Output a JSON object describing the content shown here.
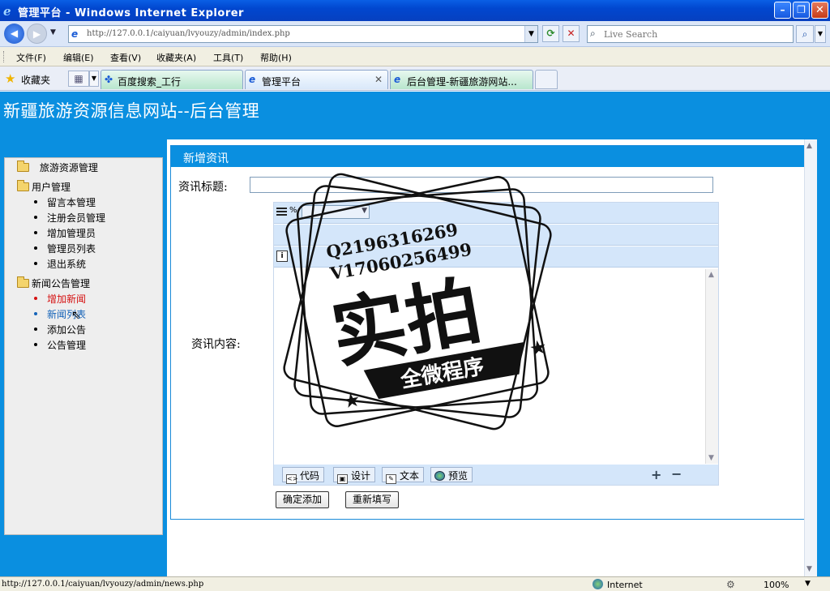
{
  "window": {
    "title": "管理平台 - Windows Internet Explorer",
    "min_glyph": "–",
    "max_glyph": "❐",
    "close_glyph": "✕"
  },
  "address_bar": {
    "url": "http://127.0.0.1/caiyuan/lvyouzy/admin/index.php",
    "search_placeholder": "Live Search"
  },
  "menu": {
    "items": [
      "文件(F)",
      "编辑(E)",
      "查看(V)",
      "收藏夹(A)",
      "工具(T)",
      "帮助(H)"
    ]
  },
  "favorites_bar": {
    "favorites_label": "收藏夹",
    "tabs": [
      {
        "label": "百度搜索_工行",
        "active": false
      },
      {
        "label": "管理平台",
        "active": true
      },
      {
        "label": "后台管理-新疆旅游网站...",
        "active": false
      }
    ]
  },
  "site": {
    "title": "新疆旅游资源信息网站--后台管理"
  },
  "sidebar": {
    "root": "旅游资源管理",
    "groups": [
      {
        "label": "用户管理",
        "items": [
          "留言本管理",
          "注册会员管理",
          "增加管理员",
          "管理员列表",
          "退出系统"
        ]
      },
      {
        "label": "新闻公告管理",
        "items": [
          "增加新闻",
          "新闻列表",
          "添加公告",
          "公告管理"
        ]
      }
    ]
  },
  "form": {
    "panel_title": "新增资讯",
    "title_label": "资讯标题:",
    "title_value": "",
    "content_label": "资讯内容:",
    "toolbar_pct": "%",
    "toolbar_info": "i",
    "modes": [
      "代码",
      "设计",
      "文本",
      "预览"
    ],
    "submit_label": "确定添加",
    "reset_label": "重新填写"
  },
  "watermark": {
    "contact_q": "Q2196316269",
    "contact_v": "V17060256499",
    "main_text": "实拍",
    "banner_text": "全微程序"
  },
  "statusbar": {
    "url": "http://127.0.0.1/caiyuan/lvyouzy/admin/news.php",
    "zone": "Internet",
    "zoom": "100%"
  },
  "colors": {
    "page_blue": "#0a8fe0",
    "link_red": "#d51111",
    "link_blue": "#1563b8"
  }
}
